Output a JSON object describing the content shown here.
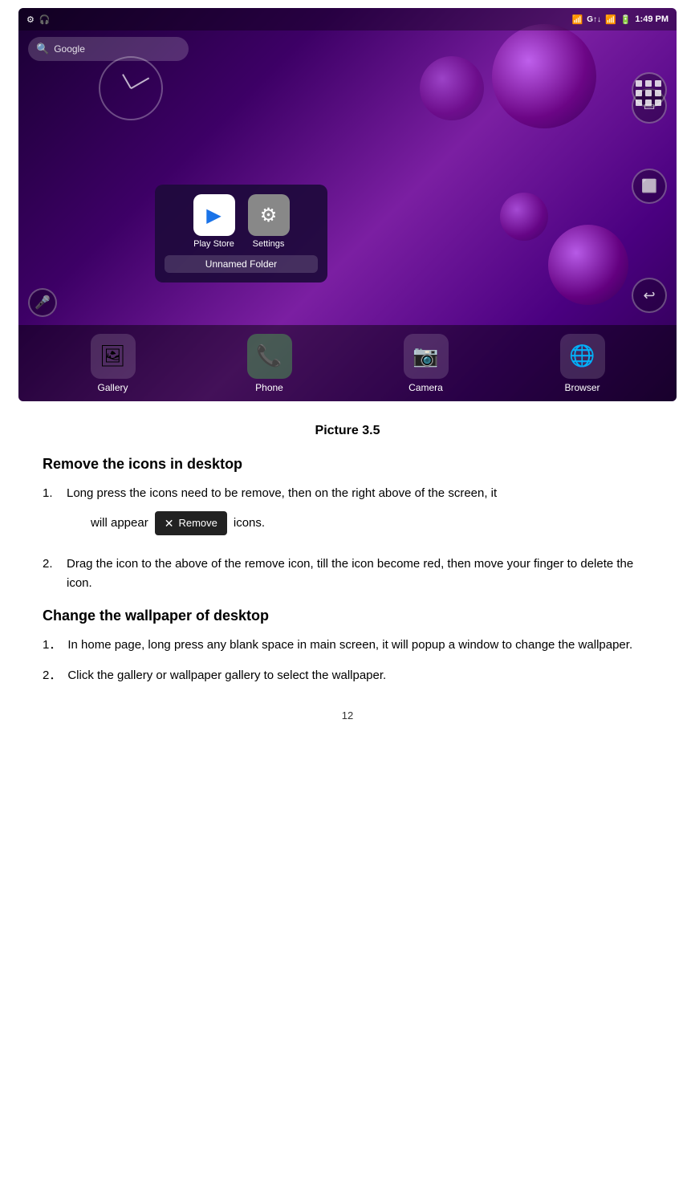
{
  "screen": {
    "time": "1:49 PM",
    "search_placeholder": "Google",
    "folder_popup": {
      "app1_label": "Play Store",
      "app2_label": "Settings",
      "folder_name": "Unnamed Folder"
    },
    "dock_items": [
      {
        "label": "Gallery",
        "icon": "🖼"
      },
      {
        "label": "Phone",
        "icon": "📞"
      },
      {
        "label": "Camera",
        "icon": "📷"
      },
      {
        "label": "Browser",
        "icon": "🌐"
      }
    ]
  },
  "caption": "Picture 3.5",
  "sections": [
    {
      "heading": "Remove the icons in desktop",
      "items": [
        {
          "num": "1.",
          "before_badge": "Long press the icons need to be remove, then on the right above of the screen, it",
          "badge_label": "Remove",
          "after_badge": "icons.",
          "intro": "will appear"
        },
        {
          "num": "2.",
          "text": "Drag the icon to the above of the remove icon, till the icon become red, then move your finger to delete the icon."
        }
      ]
    },
    {
      "heading": "Change the wallpaper of desktop",
      "items": [
        {
          "num": "1．",
          "text": "In home page, long press any blank space in main screen, it will popup a window to change the wallpaper."
        },
        {
          "num": "2．",
          "text": "Click the gallery or wallpaper gallery to select the wallpaper."
        }
      ]
    }
  ],
  "page_number": "12",
  "remove_badge": {
    "icon": "✕",
    "label": "Remove"
  }
}
